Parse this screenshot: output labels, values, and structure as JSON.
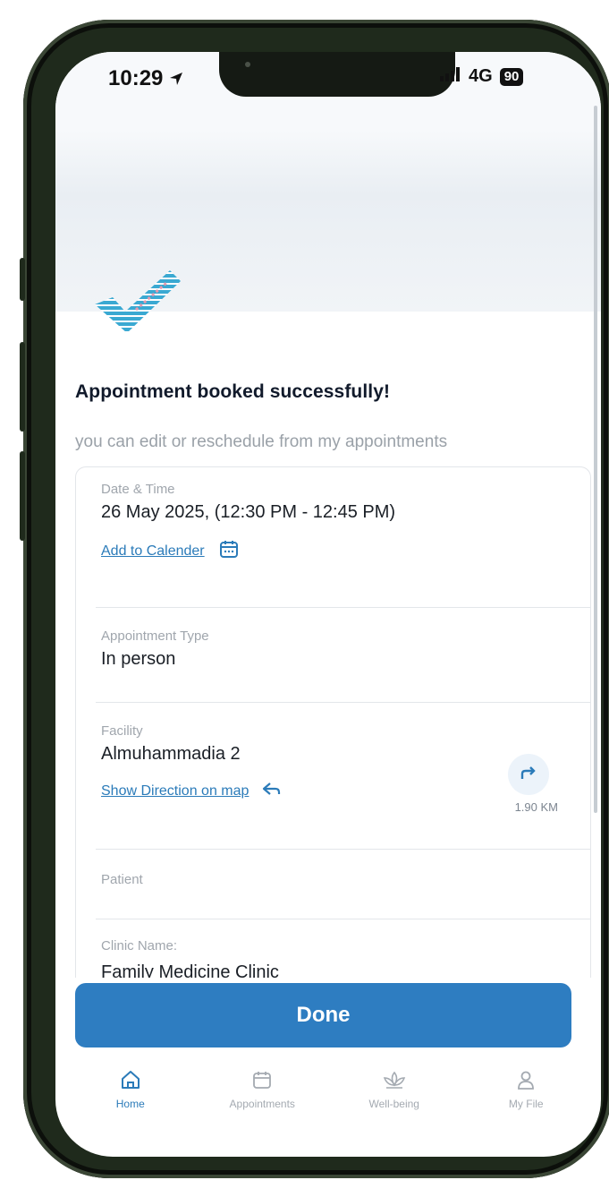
{
  "status_bar": {
    "time": "10:29",
    "network": "4G",
    "battery": "90"
  },
  "header": {
    "title": "Appointment booked successfully!",
    "subtitle": "you can edit or reschedule from my appointments"
  },
  "details": {
    "date_time_label": "Date & Time",
    "date_time_value": "26 May 2025, (12:30 PM - 12:45 PM)",
    "add_to_calendar": "Add to Calender",
    "type_label": "Appointment Type",
    "type_value": "In person",
    "facility_label": "Facility",
    "facility_value": "Almuhammadia 2",
    "show_direction": "Show Direction on map",
    "distance": "1.90 KM",
    "patient_label": "Patient",
    "clinic_label": "Clinic Name:",
    "clinic_value_partial": "Family Medicine Clinic"
  },
  "actions": {
    "done": "Done"
  },
  "tabbar": {
    "items": [
      {
        "label": "Home",
        "icon": "home-icon",
        "active": true
      },
      {
        "label": "Appointments",
        "icon": "calendar-icon",
        "active": false
      },
      {
        "label": "Well-being",
        "icon": "lotus-icon",
        "active": false
      },
      {
        "label": "My File",
        "icon": "person-icon",
        "active": false
      }
    ]
  },
  "colors": {
    "accent": "#2e7dc1",
    "link": "#2b7bb9",
    "check": "#3aa9d2"
  }
}
